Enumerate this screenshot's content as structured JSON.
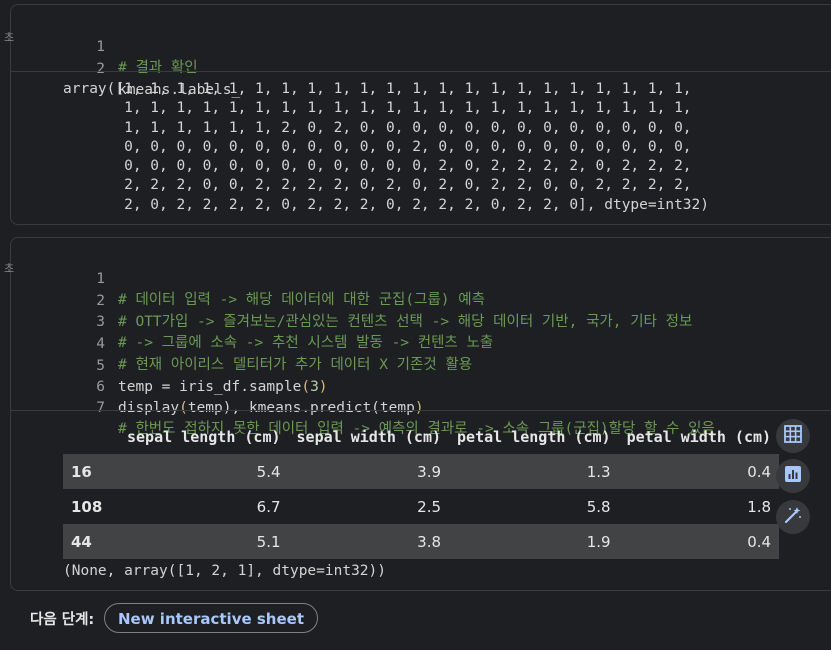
{
  "cell1": {
    "gutter_mark": "초",
    "lines": [
      {
        "num": "1",
        "text": "# 결과 확인"
      },
      {
        "num": "2",
        "text": "kmeans.labels_"
      }
    ],
    "output": "array([1, 1, 1, 1, 1, 1, 1, 1, 1, 1, 1, 1, 1, 1, 1, 1, 1, 1, 1, 1, 1, 1,\n       1, 1, 1, 1, 1, 1, 1, 1, 1, 1, 1, 1, 1, 1, 1, 1, 1, 1, 1, 1, 1, 1,\n       1, 1, 1, 1, 1, 1, 2, 0, 2, 0, 0, 0, 0, 0, 0, 0, 0, 0, 0, 0, 0, 0,\n       0, 0, 0, 0, 0, 0, 0, 0, 0, 0, 0, 2, 0, 0, 0, 0, 0, 0, 0, 0, 0, 0,\n       0, 0, 0, 0, 0, 0, 0, 0, 0, 0, 0, 0, 2, 0, 2, 2, 2, 2, 0, 2, 2, 2,\n       2, 2, 2, 0, 0, 2, 2, 2, 2, 0, 2, 0, 2, 0, 2, 2, 0, 0, 2, 2, 2, 2,\n       2, 0, 2, 2, 2, 2, 0, 2, 2, 2, 0, 2, 2, 2, 0, 2, 2, 0], dtype=int32)"
  },
  "cell2": {
    "gutter_mark": "초",
    "lines": [
      {
        "num": "1",
        "comment": "# 데이터 입력 -> 해당 데이터에 대한 군집(그룹) 예측"
      },
      {
        "num": "2",
        "comment": "# OTT가입 -> 즐겨보는/관심있는 컨텐츠 선택 -> 해당 데이터 기반, 국가, 기타 정보"
      },
      {
        "num": "3",
        "comment": "# -> 그룹에 소속 -> 추천 시스템 발동 -> 컨텐츠 노출"
      },
      {
        "num": "4",
        "comment": "# 현재 아이리스 델티터가 추가 데이터 X 기존것 활용"
      },
      {
        "num": "5",
        "pre": "temp = iris_df.sample",
        "p1": "(",
        "arg": "3",
        "p2": ")",
        "post": ""
      },
      {
        "num": "6",
        "pre": "display",
        "p1": "(",
        "arg": "temp), kmeans.predict(temp",
        "p2": ")",
        "post": ""
      },
      {
        "num": "7",
        "comment": "# 한번도 접하지 못한 데이터 입력 -> 예측의 결과로 -> 소속 그룹(군집)할당 할 수 있음"
      }
    ],
    "table": {
      "columns": [
        "",
        "sepal length (cm)",
        "sepal width (cm)",
        "petal length (cm)",
        "petal width (cm)"
      ],
      "rows": [
        {
          "index": "16",
          "values": [
            "5.4",
            "3.9",
            "1.3",
            "0.4"
          ]
        },
        {
          "index": "108",
          "values": [
            "6.7",
            "2.5",
            "5.8",
            "1.8"
          ]
        },
        {
          "index": "44",
          "values": [
            "5.1",
            "3.8",
            "1.9",
            "0.4"
          ]
        }
      ]
    },
    "output_tail": "(None, array([1, 2, 1], dtype=int32))",
    "tools": [
      "table-icon",
      "chart-icon",
      "magic-wand-icon"
    ]
  },
  "footer": {
    "next_label": "다음 단계:",
    "new_sheet_button": "New interactive sheet"
  }
}
